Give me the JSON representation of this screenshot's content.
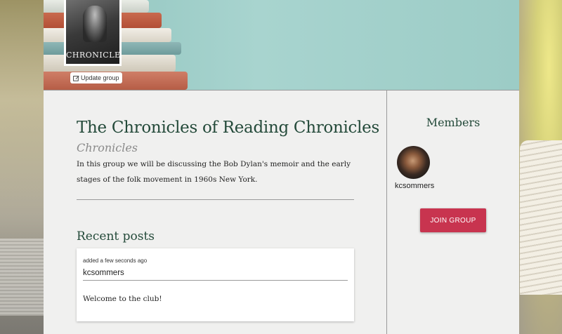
{
  "header": {
    "cover_title": "CHRONICLES",
    "update_button_label": "Update group"
  },
  "group": {
    "title": "The Chronicles of Reading Chronicles",
    "subtitle": "Chronicles",
    "description": "In this group we will be discussing the Bob Dylan's memoir and the early stages of the folk movement in 1960s New York."
  },
  "posts": {
    "section_title": "Recent posts",
    "items": [
      {
        "time": "added a few seconds ago",
        "author": "kcsommers",
        "body": "Welcome to the club!"
      }
    ]
  },
  "members": {
    "title": "Members",
    "list": [
      {
        "name": "kcsommers"
      }
    ],
    "join_button_label": "JOIN GROUP"
  },
  "colors": {
    "accent": "#c8344f",
    "heading": "#244a3a",
    "banner": "#a8d4cf"
  }
}
